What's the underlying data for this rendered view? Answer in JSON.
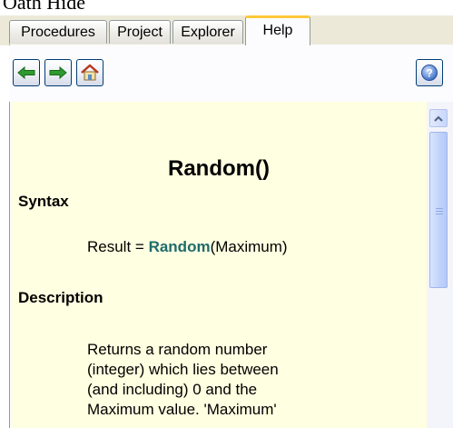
{
  "window": {
    "title": "Oath Hide"
  },
  "tabs": [
    {
      "label": "Procedures",
      "active": false
    },
    {
      "label": "Project",
      "active": false
    },
    {
      "label": "Explorer",
      "active": false
    },
    {
      "label": "Help",
      "active": true
    }
  ],
  "toolbar": {
    "back_icon": "arrow-left-icon",
    "forward_icon": "arrow-right-icon",
    "home_icon": "home-icon",
    "help_icon": "help-icon"
  },
  "help": {
    "title": "Random()",
    "syntax_heading": "Syntax",
    "syntax": {
      "before": "Result = ",
      "keyword": "Random",
      "after": "(Maximum)"
    },
    "description_heading": "Description",
    "description_lines": [
      "Returns a random number",
      "(integer) which lies between",
      "(and including) 0 and the",
      "Maximum value. 'Maximum'"
    ]
  },
  "colors": {
    "content_bg": "#ffffe1",
    "keyword": "#1f6b6b",
    "active_tab_accent": "#ffc83c",
    "arrow_green": "#2f9a2f"
  }
}
